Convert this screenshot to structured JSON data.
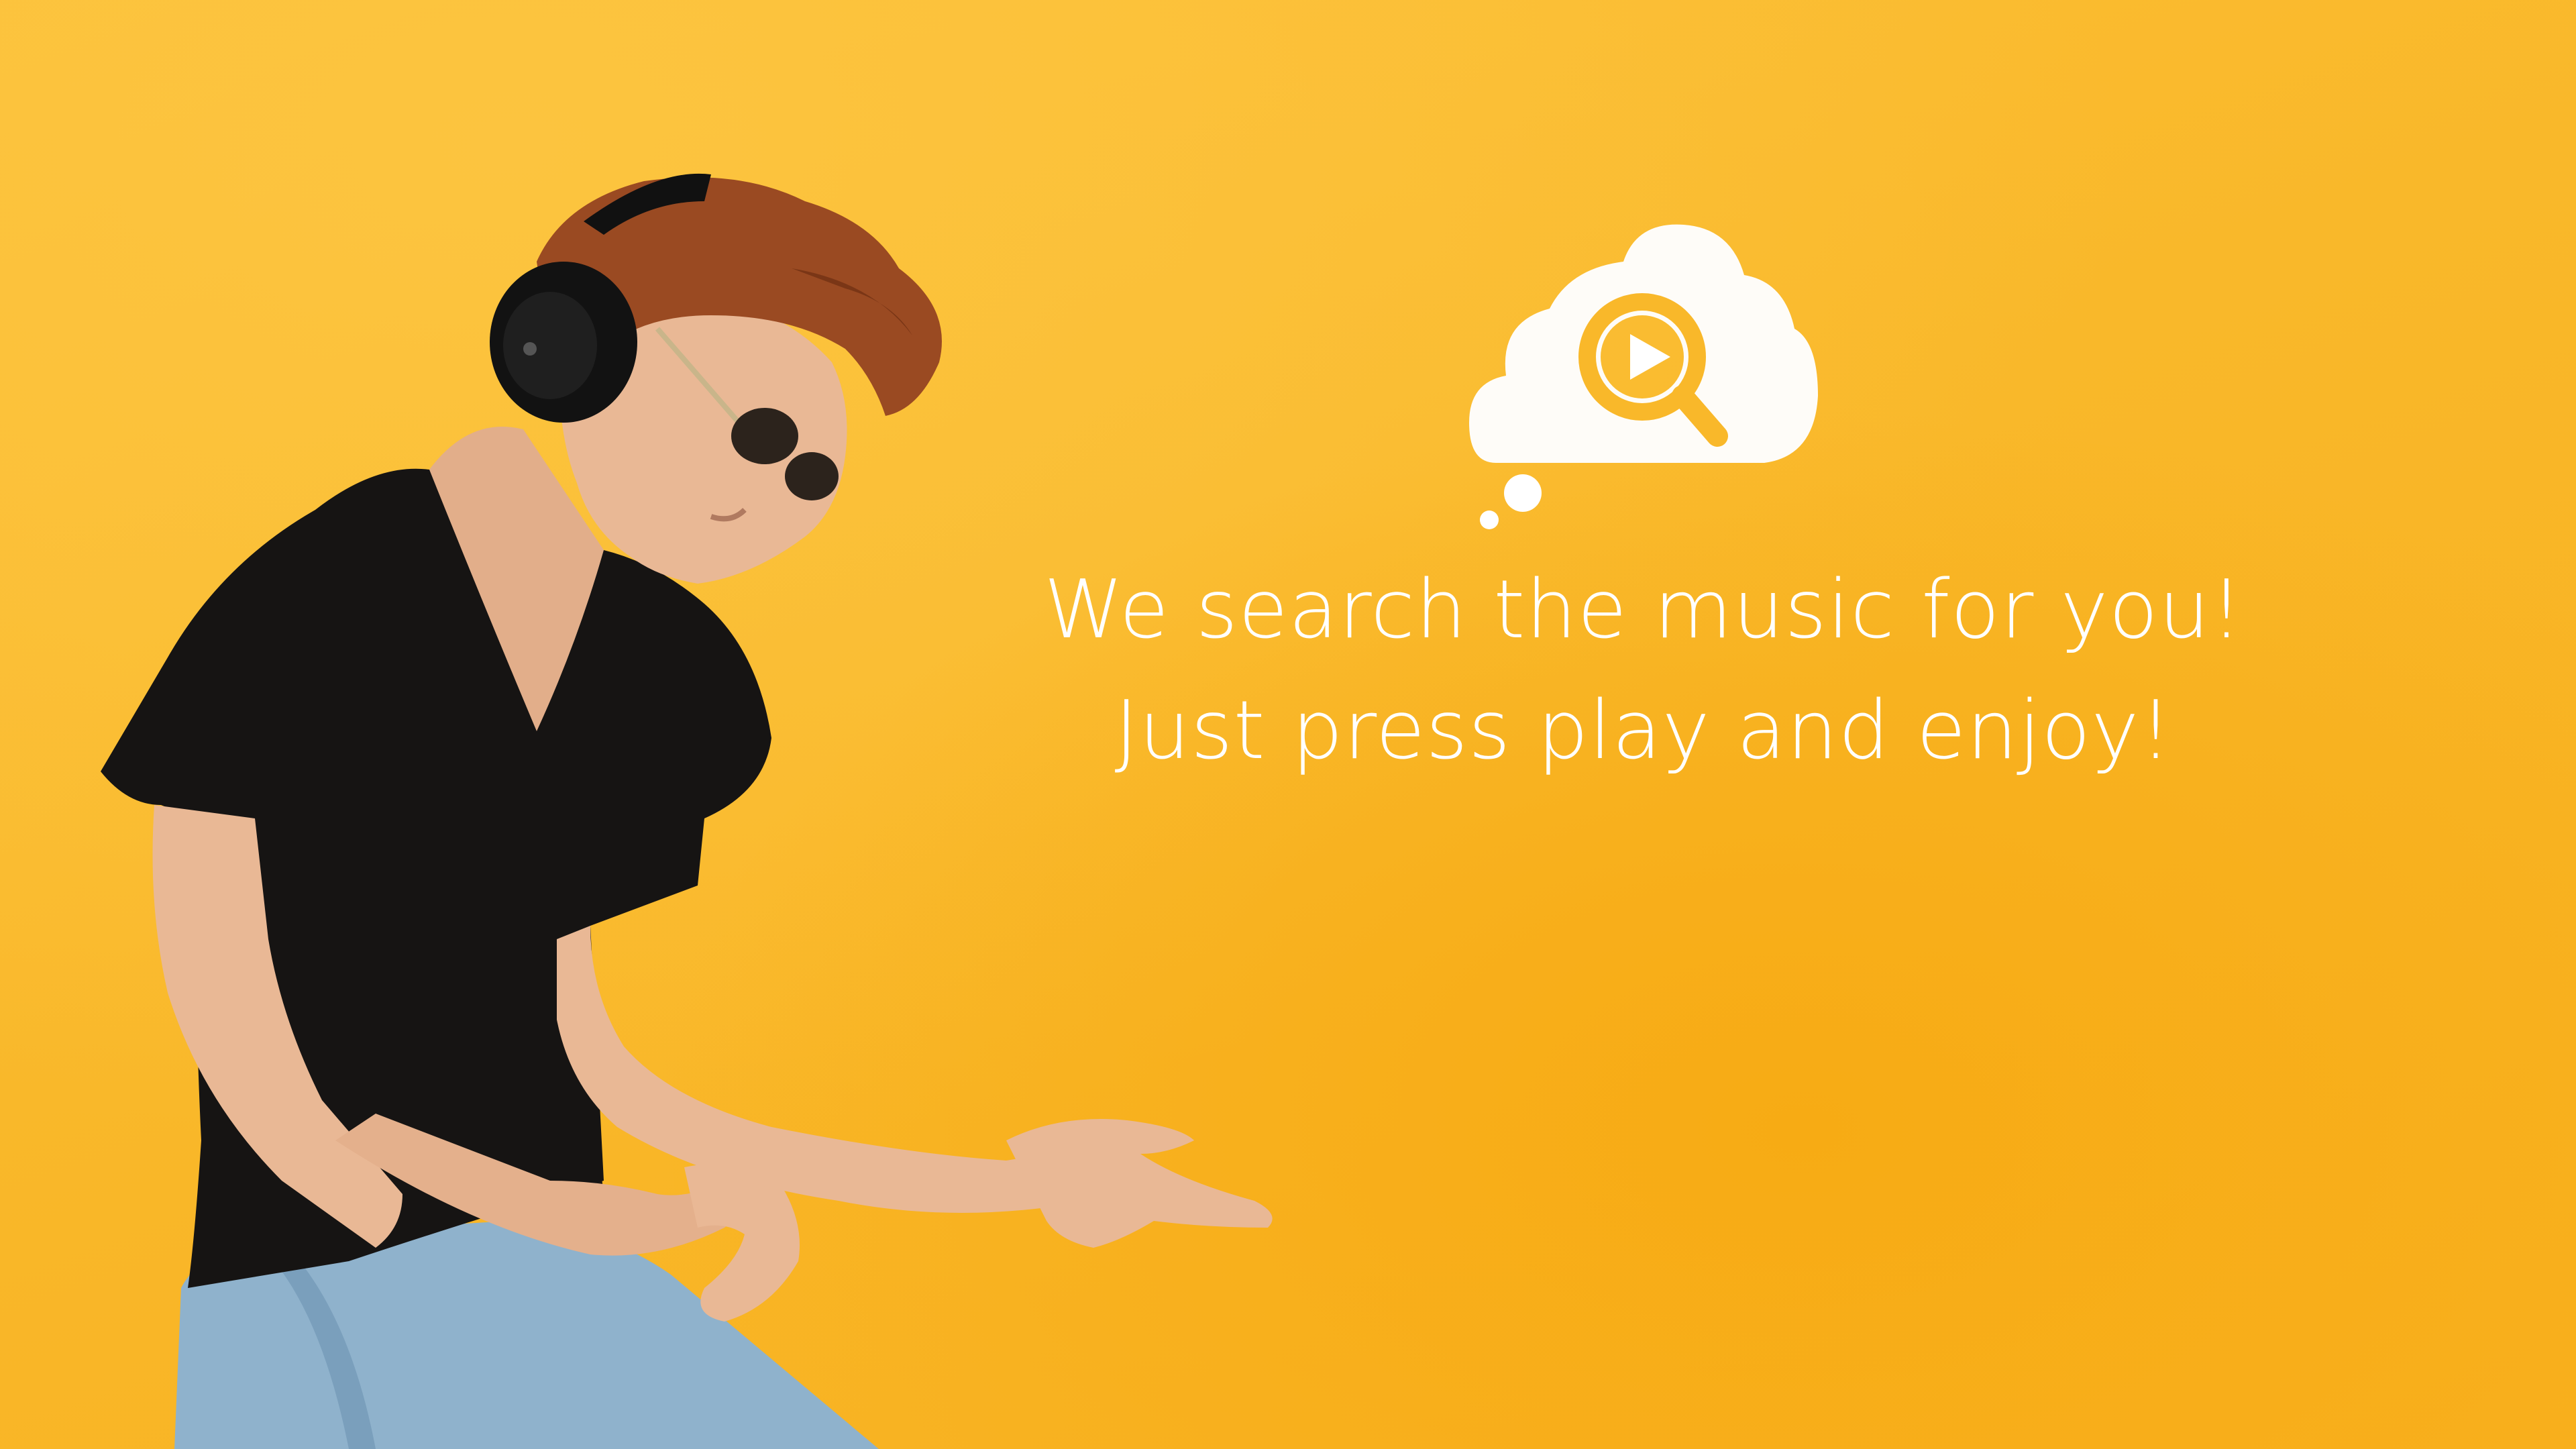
{
  "tagline": {
    "line1": "We search the music for you!",
    "line2": "Just press play and enjoy!"
  },
  "logo": {
    "icon": "cloud-play-search-icon"
  },
  "colors": {
    "background": "#f9b82a",
    "text": "#ffffff",
    "shirt": "#161413",
    "jeans": "#8fb2cc",
    "skin": "#e9b895",
    "hair": "#9a4a22"
  }
}
